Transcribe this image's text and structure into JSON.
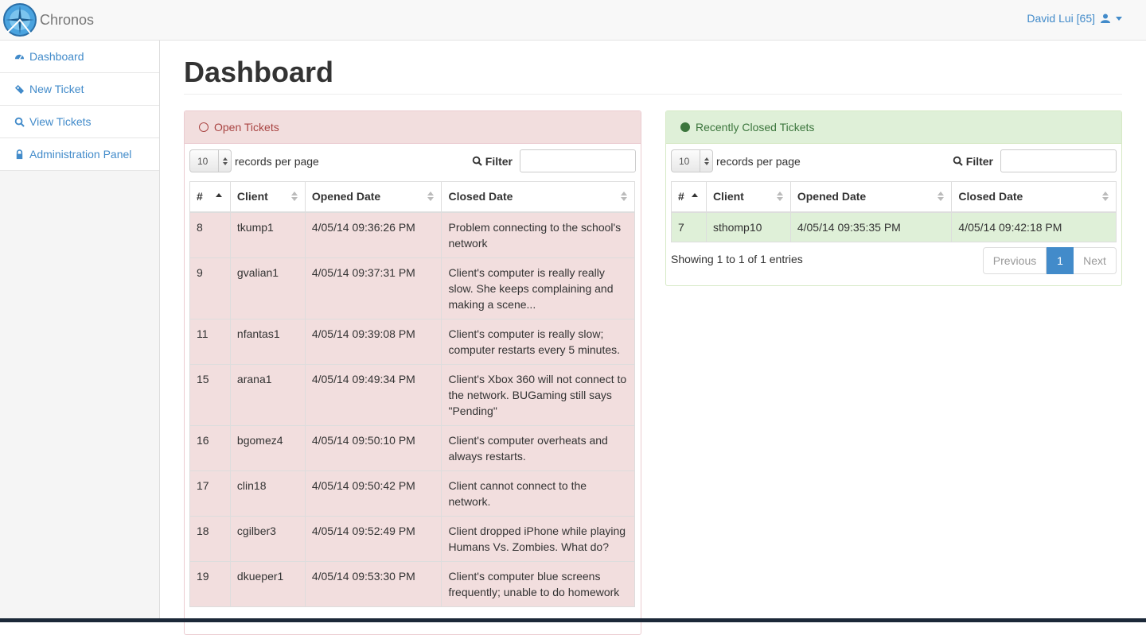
{
  "brand": {
    "name": "Chronos"
  },
  "user": {
    "label": "David Lui [65]"
  },
  "sidebar": {
    "items": [
      {
        "label": "Dashboard",
        "icon": "dashboard-icon"
      },
      {
        "label": "New Ticket",
        "icon": "ticket-icon"
      },
      {
        "label": "View Tickets",
        "icon": "search-icon"
      },
      {
        "label": "Administration Panel",
        "icon": "lock-icon"
      }
    ]
  },
  "page": {
    "title": "Dashboard"
  },
  "open_tickets": {
    "title": "Open Tickets",
    "length_value": "10",
    "length_label": "records per page",
    "filter_label": "Filter",
    "columns": [
      "#",
      "Client",
      "Opened Date",
      "Closed Date"
    ],
    "rows": [
      {
        "id": "8",
        "client": "tkump1",
        "opened": "4/05/14 09:36:26 PM",
        "closed": "Problem connecting to the school's network"
      },
      {
        "id": "9",
        "client": "gvalian1",
        "opened": "4/05/14 09:37:31 PM",
        "closed": "Client's computer is really really slow. She keeps complaining and making a scene..."
      },
      {
        "id": "11",
        "client": "nfantas1",
        "opened": "4/05/14 09:39:08 PM",
        "closed": "Client's computer is really slow; computer restarts every 5 minutes."
      },
      {
        "id": "15",
        "client": "arana1",
        "opened": "4/05/14 09:49:34 PM",
        "closed": "Client's Xbox 360 will not connect to the network. BUGaming still says \"Pending\""
      },
      {
        "id": "16",
        "client": "bgomez4",
        "opened": "4/05/14 09:50:10 PM",
        "closed": "Client's computer overheats and always restarts."
      },
      {
        "id": "17",
        "client": "clin18",
        "opened": "4/05/14 09:50:42 PM",
        "closed": "Client cannot connect to the network."
      },
      {
        "id": "18",
        "client": "cgilber3",
        "opened": "4/05/14 09:52:49 PM",
        "closed": "Client dropped iPhone while playing Humans Vs. Zombies. What do?"
      },
      {
        "id": "19",
        "client": "dkueper1",
        "opened": "4/05/14 09:53:30 PM",
        "closed": "Client's computer blue screens frequently; unable to do homework"
      }
    ]
  },
  "closed_tickets": {
    "title": "Recently Closed Tickets",
    "length_value": "10",
    "length_label": "records per page",
    "filter_label": "Filter",
    "columns": [
      "#",
      "Client",
      "Opened Date",
      "Closed Date"
    ],
    "rows": [
      {
        "id": "7",
        "client": "sthomp10",
        "opened": "4/05/14 09:35:35 PM",
        "closed": "4/05/14 09:42:18 PM"
      }
    ],
    "info": "Showing 1 to 1 of 1 entries",
    "pager": {
      "previous": "Previous",
      "current": "1",
      "next": "Next"
    }
  },
  "colors": {
    "link": "#428bca",
    "open_bg": "#f2dede",
    "open_text": "#a94442",
    "closed_bg": "#dff0d8",
    "closed_text": "#3c763d"
  }
}
